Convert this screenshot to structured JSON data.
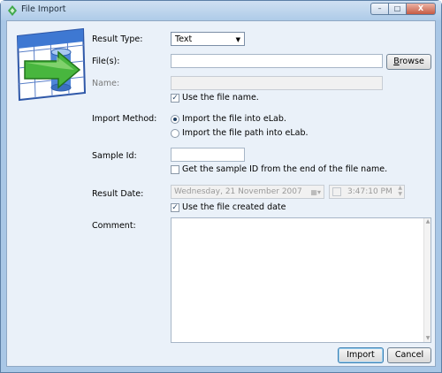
{
  "window": {
    "title": "File Import"
  },
  "titlebar_buttons": {
    "minimize": "–",
    "maximize": "□",
    "close": "X"
  },
  "form": {
    "result_type": {
      "label": "Result Type:",
      "value": "Text"
    },
    "files": {
      "label": "File(s):",
      "value": "",
      "browse_label": "Browse",
      "browse_underline": "B"
    },
    "name": {
      "label": "Name:",
      "value": "",
      "use_file_name_label": "Use the file name.",
      "use_file_name_checked": true
    },
    "import_method": {
      "label": "Import Method:",
      "options": [
        {
          "label": "Import the file into eLab.",
          "selected": true
        },
        {
          "label": "Import the file path into eLab.",
          "selected": false
        }
      ]
    },
    "sample_id": {
      "label": "Sample Id:",
      "value": "",
      "from_file_label": "Get the sample ID from the end of the file name.",
      "from_file_checked": false
    },
    "result_date": {
      "label": "Result Date:",
      "date": "Wednesday, 21 November 2007",
      "time": "3:47:10 PM",
      "time_checked": false,
      "use_created_label": "Use the file created date",
      "use_created_checked": true
    },
    "comment": {
      "label": "Comment:",
      "value": ""
    }
  },
  "actions": {
    "import_label": "Import",
    "cancel_label": "Cancel"
  }
}
